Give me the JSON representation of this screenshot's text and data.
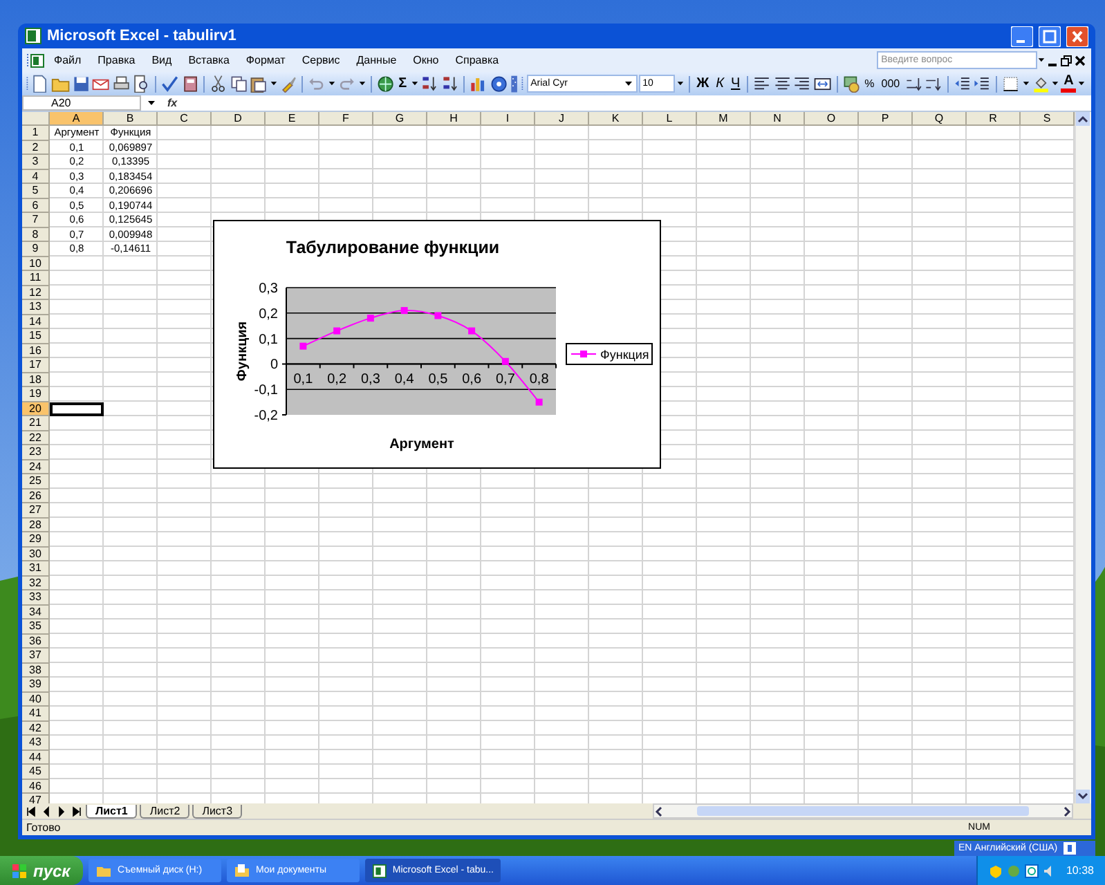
{
  "window": {
    "title": "Microsoft Excel - tabulirv1"
  },
  "menu": [
    "Файл",
    "Правка",
    "Вид",
    "Вставка",
    "Формат",
    "Сервис",
    "Данные",
    "Окно",
    "Справка"
  ],
  "help_search": {
    "placeholder": "Введите вопрос"
  },
  "toolbar": {
    "sum_button": "Σ",
    "font": "Arial Cyr",
    "size": "10",
    "style_buttons": [
      "Ж",
      "К",
      "Ч"
    ],
    "number_buttons": [
      "%",
      "000"
    ],
    "font_color_button": "A"
  },
  "formula_bar": {
    "name_box": "A20",
    "function_label": "fx"
  },
  "sheet": {
    "columns": [
      {
        "label": "A",
        "selected": true
      },
      {
        "label": "B",
        "selected": false
      },
      {
        "label": "C",
        "selected": false
      },
      {
        "label": "D",
        "selected": false
      },
      {
        "label": "E",
        "selected": false
      },
      {
        "label": "F",
        "selected": false
      },
      {
        "label": "G",
        "selected": false
      },
      {
        "label": "H",
        "selected": false
      },
      {
        "label": "I",
        "selected": false
      },
      {
        "label": "J",
        "selected": false
      },
      {
        "label": "K",
        "selected": false
      },
      {
        "label": "L",
        "selected": false
      },
      {
        "label": "M",
        "selected": false
      },
      {
        "label": "N",
        "selected": false
      },
      {
        "label": "O",
        "selected": false
      },
      {
        "label": "P",
        "selected": false
      },
      {
        "label": "Q",
        "selected": false
      },
      {
        "label": "R",
        "selected": false
      },
      {
        "label": "S",
        "selected": false
      }
    ],
    "rows": [
      {
        "number": "1",
        "selected": false,
        "cells": [
          "Аргумент",
          "Функция"
        ]
      },
      {
        "number": "2",
        "selected": false,
        "cells": [
          "0,1",
          "0,069897"
        ]
      },
      {
        "number": "3",
        "selected": false,
        "cells": [
          "0,2",
          "0,13395"
        ]
      },
      {
        "number": "4",
        "selected": false,
        "cells": [
          "0,3",
          "0,183454"
        ]
      },
      {
        "number": "5",
        "selected": false,
        "cells": [
          "0,4",
          "0,206696"
        ]
      },
      {
        "number": "6",
        "selected": false,
        "cells": [
          "0,5",
          "0,190744"
        ]
      },
      {
        "number": "7",
        "selected": false,
        "cells": [
          "0,6",
          "0,125645"
        ]
      },
      {
        "number": "8",
        "selected": false,
        "cells": [
          "0,7",
          "0,009948"
        ]
      },
      {
        "number": "9",
        "selected": false,
        "cells": [
          "0,8",
          "-0,14611"
        ]
      },
      {
        "number": "10",
        "selected": false
      },
      {
        "number": "11",
        "selected": false
      },
      {
        "number": "12",
        "selected": false
      },
      {
        "number": "13",
        "selected": false
      },
      {
        "number": "14",
        "selected": false
      },
      {
        "number": "15",
        "selected": false
      },
      {
        "number": "16",
        "selected": false
      },
      {
        "number": "17",
        "selected": false
      },
      {
        "number": "18",
        "selected": false
      },
      {
        "number": "19",
        "selected": false
      },
      {
        "number": "20",
        "selected": true
      },
      {
        "number": "21",
        "selected": false
      },
      {
        "number": "22",
        "selected": false
      },
      {
        "number": "23",
        "selected": false
      },
      {
        "number": "24",
        "selected": false
      },
      {
        "number": "25",
        "selected": false
      },
      {
        "number": "26",
        "selected": false
      },
      {
        "number": "27",
        "selected": false
      },
      {
        "number": "28",
        "selected": false
      },
      {
        "number": "29",
        "selected": false
      },
      {
        "number": "30",
        "selected": false
      },
      {
        "number": "31",
        "selected": false
      },
      {
        "number": "32",
        "selected": false
      },
      {
        "number": "33",
        "selected": false
      },
      {
        "number": "34",
        "selected": false
      },
      {
        "number": "35",
        "selected": false
      },
      {
        "number": "36",
        "selected": false
      },
      {
        "number": "37",
        "selected": false
      },
      {
        "number": "38",
        "selected": false
      },
      {
        "number": "39",
        "selected": false
      },
      {
        "number": "40",
        "selected": false
      },
      {
        "number": "41",
        "selected": false
      },
      {
        "number": "42",
        "selected": false
      },
      {
        "number": "43",
        "selected": false
      },
      {
        "number": "44",
        "selected": false
      },
      {
        "number": "45",
        "selected": false
      },
      {
        "number": "46",
        "selected": false
      },
      {
        "number": "47",
        "selected": false
      }
    ]
  },
  "chart": {
    "chart_data": {
      "type": "line",
      "title": "Табулирование функции",
      "xlabel": "Аргумент",
      "ylabel": "Функция",
      "categories": [
        "0,1",
        "0,2",
        "0,3",
        "0,4",
        "0,5",
        "0,6",
        "0,7",
        "0,8"
      ],
      "grid": true,
      "series": [
        {
          "name": "Функция",
          "color": "#ff00ff",
          "marker": "square",
          "values": [
            0.07,
            0.13,
            0.18,
            0.21,
            0.19,
            0.13,
            0.01,
            -0.15
          ]
        }
      ],
      "ylim": [
        -0.2,
        0.3
      ],
      "yticks": [
        {
          "value": -0.2,
          "label": "-0,2"
        },
        {
          "value": -0.1,
          "label": "-0,1"
        },
        {
          "value": 0,
          "label": "0"
        },
        {
          "value": 0.1,
          "label": "0,1"
        },
        {
          "value": 0.2,
          "label": "0,2"
        },
        {
          "value": 0.3,
          "label": "0,3"
        }
      ]
    }
  },
  "sheet_tabs": [
    {
      "label": "Лист1",
      "selected": true
    },
    {
      "label": "Лист2",
      "selected": false
    },
    {
      "label": "Лист3",
      "selected": false
    }
  ],
  "status_bar": {
    "text": "Готово",
    "indicator": "NUM"
  },
  "language_bar": {
    "text": "EN Английский (США)"
  },
  "taskbar": {
    "start": "пуск",
    "tasks": [
      {
        "label": "Съемный диск (H:)",
        "selected": false,
        "kind": "folder"
      },
      {
        "label": "Мои документы",
        "selected": false,
        "kind": "documents"
      },
      {
        "label": "Microsoft Excel - tabu...",
        "selected": true,
        "kind": "excel"
      }
    ],
    "clock": "10:38"
  }
}
